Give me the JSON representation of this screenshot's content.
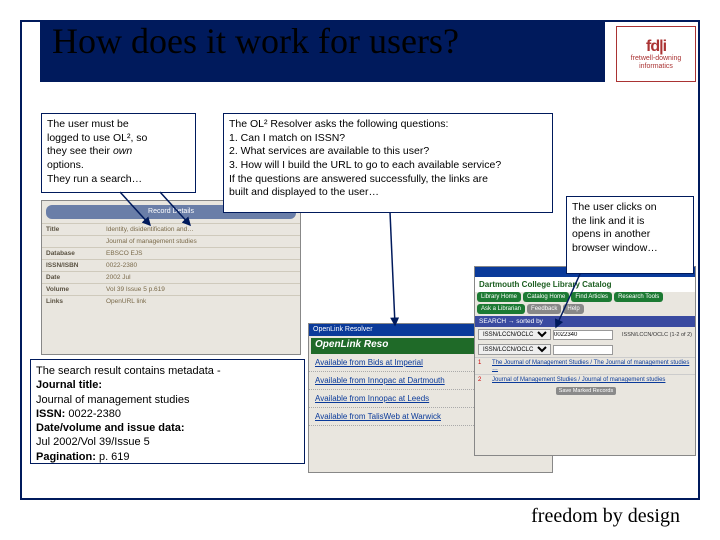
{
  "title": "How does it work for users?",
  "logo": {
    "mark": "fd|i",
    "line1": "fretwell-downing",
    "line2": "informatics"
  },
  "box1": {
    "l1": "The user must be",
    "l2": "logged to use OL², so",
    "l3": "they see their ",
    "l3em": "own",
    "l4": "options.",
    "l5": "They run a search…"
  },
  "box2": {
    "l1": "The OL² Resolver asks the following questions:",
    "l2": "1. Can I match on ISSN?",
    "l3": "2. What services are available to this user?",
    "l4": "3. How will I build the URL to go to each available service?",
    "l5": "If  the questions are answered successfully, the links are",
    "l6": "built and displayed to the user…"
  },
  "box3": {
    "l1": "The user clicks on",
    "l2": "the link and it is",
    "l3": "opens in another",
    "l4": "browser window…"
  },
  "box4": {
    "l1": "The search result contains metadata -",
    "b1": "Journal title:",
    "v1": "Journal of management studies",
    "b2": "ISSN:  ",
    "v2": "0022-2380",
    "b3": "Date/volume and issue data:",
    "v3": "Jul 2002/Vol 39/Issue 5",
    "b4": "Pagination: ",
    "v4": "p. 619"
  },
  "ss1": {
    "header": "Record Details",
    "rows": [
      {
        "lbl": "Title",
        "val": "Identity, disidentification and…"
      },
      {
        "lbl": "",
        "val": "Journal of management studies"
      },
      {
        "lbl": "Database",
        "val": "EBSCO EJS"
      },
      {
        "lbl": "ISSN/ISBN",
        "val": "0022-2380"
      },
      {
        "lbl": "Date",
        "val": "2002 Jul"
      },
      {
        "lbl": "Volume",
        "val": "Vol 39 Issue 5 p.619"
      },
      {
        "lbl": "Links",
        "val": "OpenURL link"
      }
    ]
  },
  "ss2": {
    "title": "OpenLink Resolver",
    "banner": "OpenLink Reso",
    "lines": [
      "Available from Bids at Imperial",
      "Available from Innopac at Dartmouth",
      "Available from Innopac at Leeds",
      "Available from TalisWeb at Warwick"
    ]
  },
  "ss3": {
    "banner": "Dartmouth College Library Catalog",
    "tabs": [
      "Library Home",
      "Catalog Home",
      "Find Articles",
      "Research Tools",
      "Ask a Librarian",
      "Feedback",
      "Help"
    ],
    "searchLabel": "SEARCH → sorted by",
    "field1": "ISSN/LCCN/OCLC",
    "value1": "0022340",
    "field2": "ISSN/LCCN/OCLC (1-2 of 2)",
    "results": [
      {
        "n": "1",
        "t": "The Journal of Management Studies / The Journal of management studies …"
      },
      {
        "n": "2",
        "t": "Journal of Management Studies / Journal of management studies"
      }
    ],
    "btn": "Save Marked Records"
  },
  "tagline": "freedom by design"
}
